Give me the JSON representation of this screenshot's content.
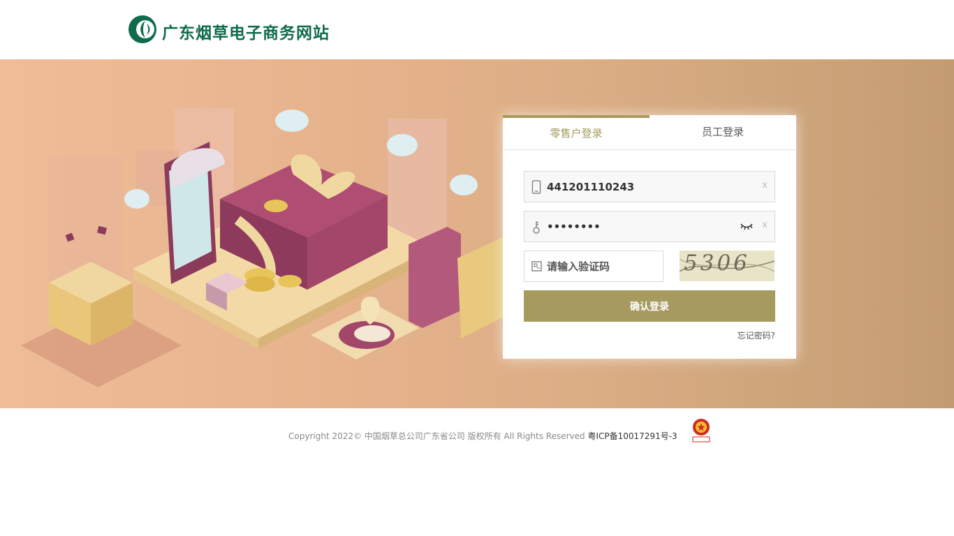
{
  "header": {
    "logo_text": "广东烟草电子商务网站",
    "logo_icon": "tobacco-leaf-logo"
  },
  "login": {
    "tabs": [
      {
        "label": "零售户登录",
        "active": true
      },
      {
        "label": "员工登录",
        "active": false
      }
    ],
    "username": {
      "value": "441201110243",
      "icon": "phone-icon",
      "clear": "x"
    },
    "password": {
      "value": "••••••••",
      "icon": "key-icon",
      "clear": "x",
      "toggle_icon": "eye-closed-icon"
    },
    "captcha": {
      "placeholder": "请输入验证码",
      "icon": "captcha-icon",
      "image_text": "5306"
    },
    "submit_label": "确认登录",
    "forgot_label": "忘记密码?"
  },
  "footer": {
    "copyright": "Copyright 2022© 中国烟草总公司广东省公司 版权所有 All Rights Reserved ",
    "icp": "粤ICP备10017291号-3",
    "badge_icon": "police-badge-icon"
  },
  "colors": {
    "accent": "#a69a5f",
    "brand_green": "#0e6b4b"
  }
}
